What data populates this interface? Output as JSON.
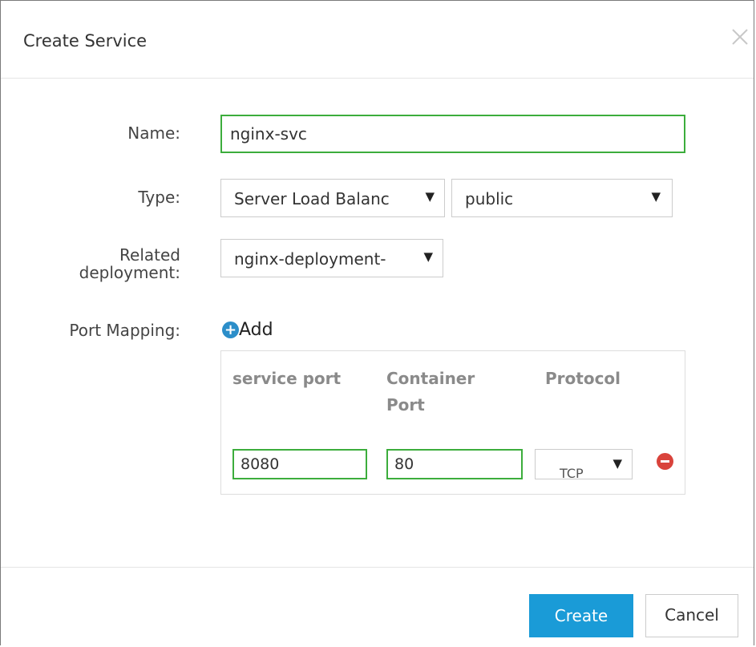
{
  "dialog": {
    "title": "Create Service",
    "close_icon": "close-icon"
  },
  "form": {
    "name_label": "Name:",
    "name_value": "nginx-svc",
    "type_label": "Type:",
    "type_value": "Server Load Balanc",
    "network_value": "public",
    "deployment_label_line1": "Related",
    "deployment_label_line2": "deployment:",
    "deployment_value": "nginx-deployment-",
    "port_mapping_label": "Port Mapping:",
    "add_label": "Add",
    "add_icon": "plus-circle-icon"
  },
  "port_table": {
    "headers": {
      "service_port": "service port",
      "container_port_line1": "Container",
      "container_port_line2": "Port",
      "protocol": "Protocol"
    },
    "rows": [
      {
        "service_port": "8080",
        "container_port": "80",
        "protocol": "TCP",
        "remove_icon": "minus-circle-icon"
      }
    ]
  },
  "footer": {
    "create_label": "Create",
    "cancel_label": "Cancel"
  },
  "colors": {
    "focus_border": "#3cad3c",
    "primary_button": "#1a9bd7",
    "add_icon": "#2c8ec9",
    "remove_icon": "#d9433b"
  }
}
